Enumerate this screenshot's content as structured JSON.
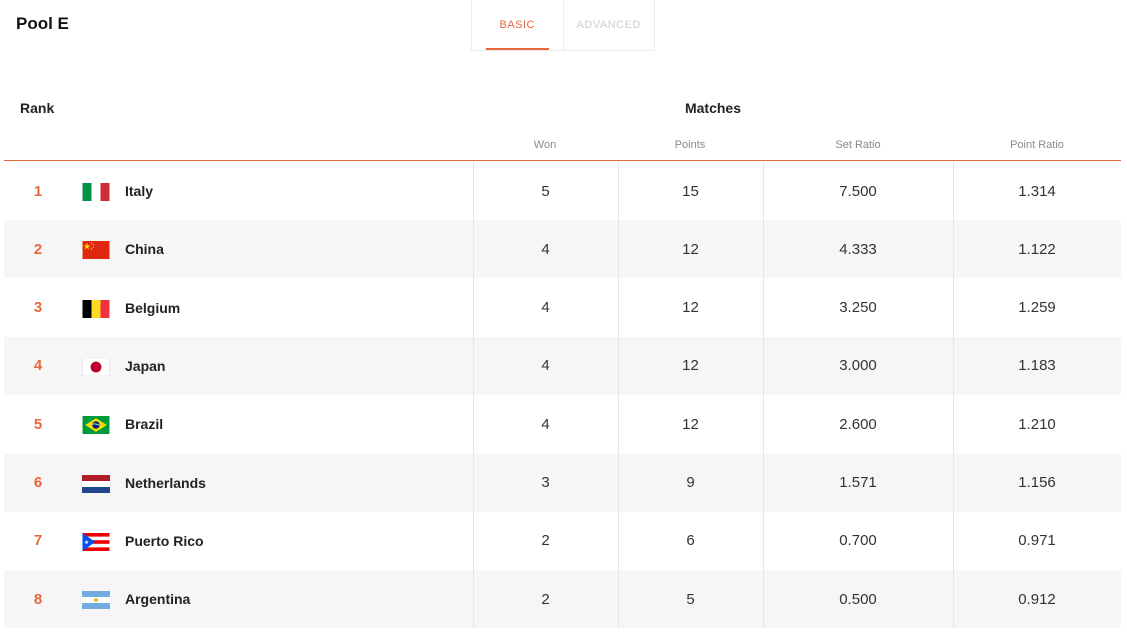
{
  "pool_title": "Pool E",
  "tabs": [
    {
      "label": "BASIC",
      "active": true
    },
    {
      "label": "ADVANCED",
      "active": false
    }
  ],
  "headers": {
    "rank": "Rank",
    "matches": "Matches",
    "won": "Won",
    "points": "Points",
    "set_ratio": "Set Ratio",
    "point_ratio": "Point Ratio"
  },
  "colors": {
    "accent": "#e8663c"
  },
  "rows": [
    {
      "rank": "1",
      "country": "Italy",
      "flag": "italy-flag-icon",
      "won": "5",
      "points": "15",
      "set_ratio": "7.500",
      "point_ratio": "1.314"
    },
    {
      "rank": "2",
      "country": "China",
      "flag": "china-flag-icon",
      "won": "4",
      "points": "12",
      "set_ratio": "4.333",
      "point_ratio": "1.122"
    },
    {
      "rank": "3",
      "country": "Belgium",
      "flag": "belgium-flag-icon",
      "won": "4",
      "points": "12",
      "set_ratio": "3.250",
      "point_ratio": "1.259"
    },
    {
      "rank": "4",
      "country": "Japan",
      "flag": "japan-flag-icon",
      "won": "4",
      "points": "12",
      "set_ratio": "3.000",
      "point_ratio": "1.183"
    },
    {
      "rank": "5",
      "country": "Brazil",
      "flag": "brazil-flag-icon",
      "won": "4",
      "points": "12",
      "set_ratio": "2.600",
      "point_ratio": "1.210"
    },
    {
      "rank": "6",
      "country": "Netherlands",
      "flag": "netherlands-flag-icon",
      "won": "3",
      "points": "9",
      "set_ratio": "1.571",
      "point_ratio": "1.156"
    },
    {
      "rank": "7",
      "country": "Puerto Rico",
      "flag": "puerto-rico-flag-icon",
      "won": "2",
      "points": "6",
      "set_ratio": "0.700",
      "point_ratio": "0.971"
    },
    {
      "rank": "8",
      "country": "Argentina",
      "flag": "argentina-flag-icon",
      "won": "2",
      "points": "5",
      "set_ratio": "0.500",
      "point_ratio": "0.912"
    }
  ]
}
